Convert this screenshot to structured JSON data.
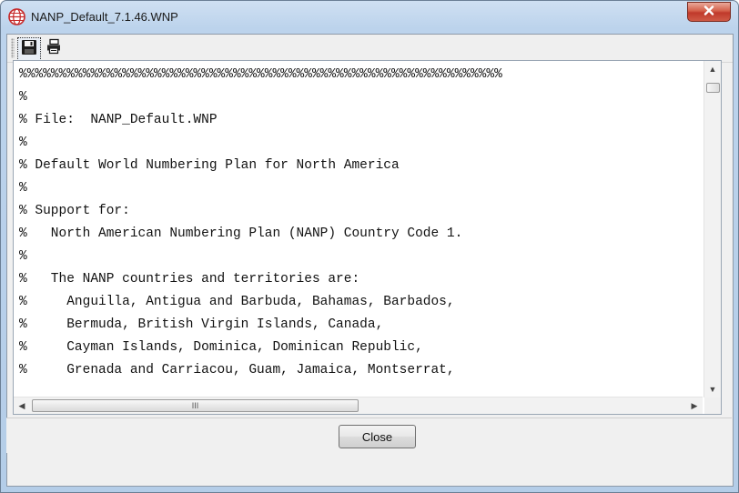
{
  "window": {
    "title": "NANP_Default_7.1.46.WNP",
    "app_icon": "globe-icon",
    "close_icon": "close-x-icon",
    "close_color": "#c0392b"
  },
  "toolbar": {
    "save_icon": "floppy-disk-icon",
    "print_icon": "printer-icon"
  },
  "content": {
    "lines": [
      "%%%%%%%%%%%%%%%%%%%%%%%%%%%%%%%%%%%%%%%%%%%%%%%%%%%%%%%%%%%%%",
      "%",
      "% File:  NANP_Default.WNP",
      "%",
      "% Default World Numbering Plan for North America",
      "%",
      "% Support for:",
      "%   North American Numbering Plan (NANP) Country Code 1.",
      "%",
      "%   The NANP countries and territories are:",
      "%     Anguilla, Antigua and Barbuda, Bahamas, Barbados,",
      "%     Bermuda, British Virgin Islands, Canada,",
      "%     Cayman Islands, Dominica, Dominican Republic,",
      "%     Grenada and Carriacou, Guam, Jamaica, Montserrat,"
    ]
  },
  "scrollbar": {
    "horizontal_thumb_grip": "III"
  },
  "footer": {
    "close_label": "Close"
  }
}
